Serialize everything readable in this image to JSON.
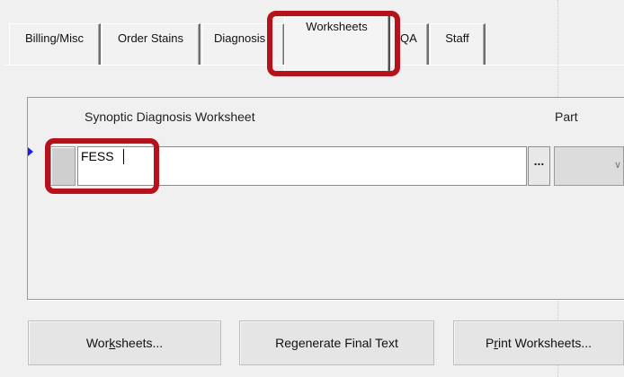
{
  "tabs": [
    {
      "label": "Billing/Misc",
      "active": false
    },
    {
      "label": "Order Stains",
      "active": false
    },
    {
      "label": "Diagnosis",
      "active": false
    },
    {
      "label": "Worksheets",
      "active": true
    },
    {
      "label": "QA",
      "active": false
    },
    {
      "label": "Staff",
      "active": false
    }
  ],
  "grid": {
    "header_worksheet": "Synoptic Diagnosis Worksheet",
    "header_part": "Part",
    "row_value": "FESS",
    "ellipsis_label": "...",
    "part_value": ""
  },
  "buttons": {
    "worksheets": {
      "before": "Wor",
      "accel": "k",
      "after": "sheets..."
    },
    "regenerate": {
      "before": "Re",
      "accel": "g",
      "after": "enerate Final Text"
    },
    "print": {
      "before": "P",
      "accel": "r",
      "after": "int Worksheets..."
    }
  },
  "colors": {
    "highlight": "#b7121a",
    "row_pointer": "#1a1aff",
    "background": "#f0f0f0"
  },
  "icons": {
    "row_pointer": "triangle-right",
    "dropdown": "chevron-down"
  }
}
